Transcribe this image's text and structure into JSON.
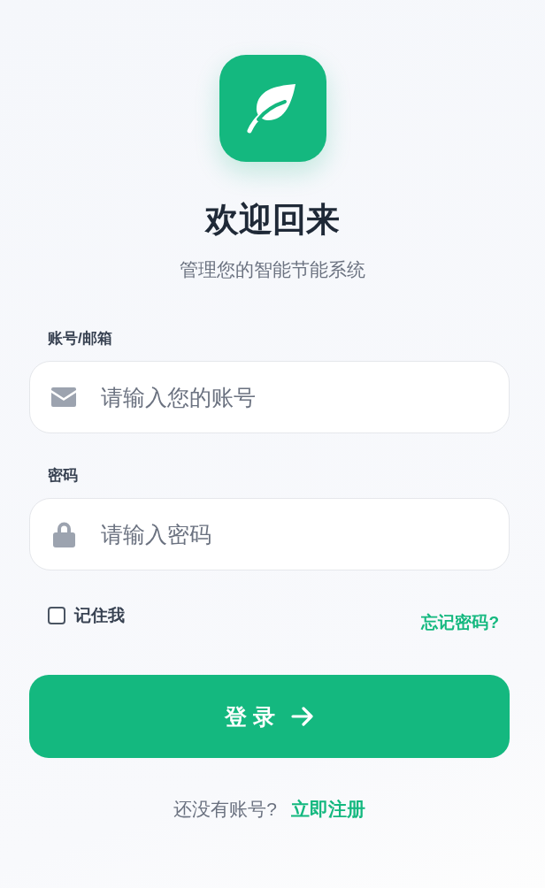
{
  "title": "欢迎回来",
  "subtitle": "管理您的智能节能系统",
  "fields": [
    {
      "label": "账号/邮箱",
      "placeholder": "请输入您的账号",
      "kind": "account"
    },
    {
      "label": "密码",
      "placeholder": "请输入密码",
      "kind": "password"
    }
  ],
  "remember": {
    "label": "记住我",
    "checked": false
  },
  "forgot_link": "忘记密码?",
  "login_button": "登 录",
  "footer": {
    "text": "还没有账号?",
    "link": "立即注册"
  }
}
